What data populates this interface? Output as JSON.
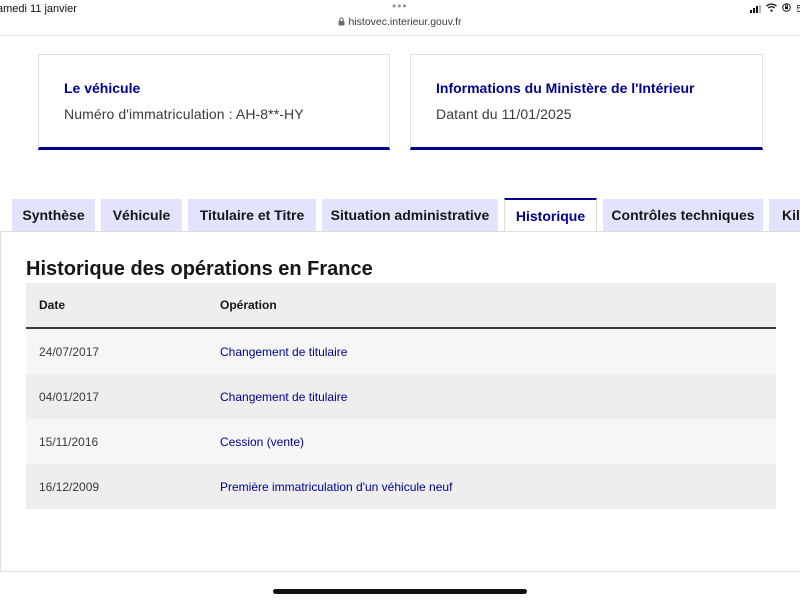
{
  "statusbar": {
    "time": "amedi 11 janvier",
    "url": "histovec.interieur.gouv.fr",
    "battery_text": "5"
  },
  "vehicle_card": {
    "title": "Le véhicule",
    "value": "Numéro d'immatriculation : AH-8**-HY"
  },
  "ministry_card": {
    "title": "Informations du Ministère de l'Intérieur",
    "value": "Datant du 11/01/2025"
  },
  "tabs": [
    {
      "label": "Synthèse",
      "active": false
    },
    {
      "label": "Véhicule",
      "active": false
    },
    {
      "label": "Titulaire et Titre",
      "active": false
    },
    {
      "label": "Situation administrative",
      "active": false
    },
    {
      "label": "Historique",
      "active": true
    },
    {
      "label": "Contrôles techniques",
      "active": false
    },
    {
      "label": "Kilo",
      "active": false
    }
  ],
  "history": {
    "title": "Historique des opérations en France",
    "headers": {
      "date": "Date",
      "operation": "Opération"
    },
    "rows": [
      {
        "date": "24/07/2017",
        "operation": "Changement de titulaire"
      },
      {
        "date": "04/01/2017",
        "operation": "Changement de titulaire"
      },
      {
        "date": "15/11/2016",
        "operation": "Cession (vente)"
      },
      {
        "date": "16/12/2009",
        "operation": "Première immatriculation d'un véhicule neuf"
      }
    ]
  },
  "colors": {
    "accent": "#000091",
    "tab_background": "#e3e3fd",
    "row_alt": "#eeeeee"
  }
}
